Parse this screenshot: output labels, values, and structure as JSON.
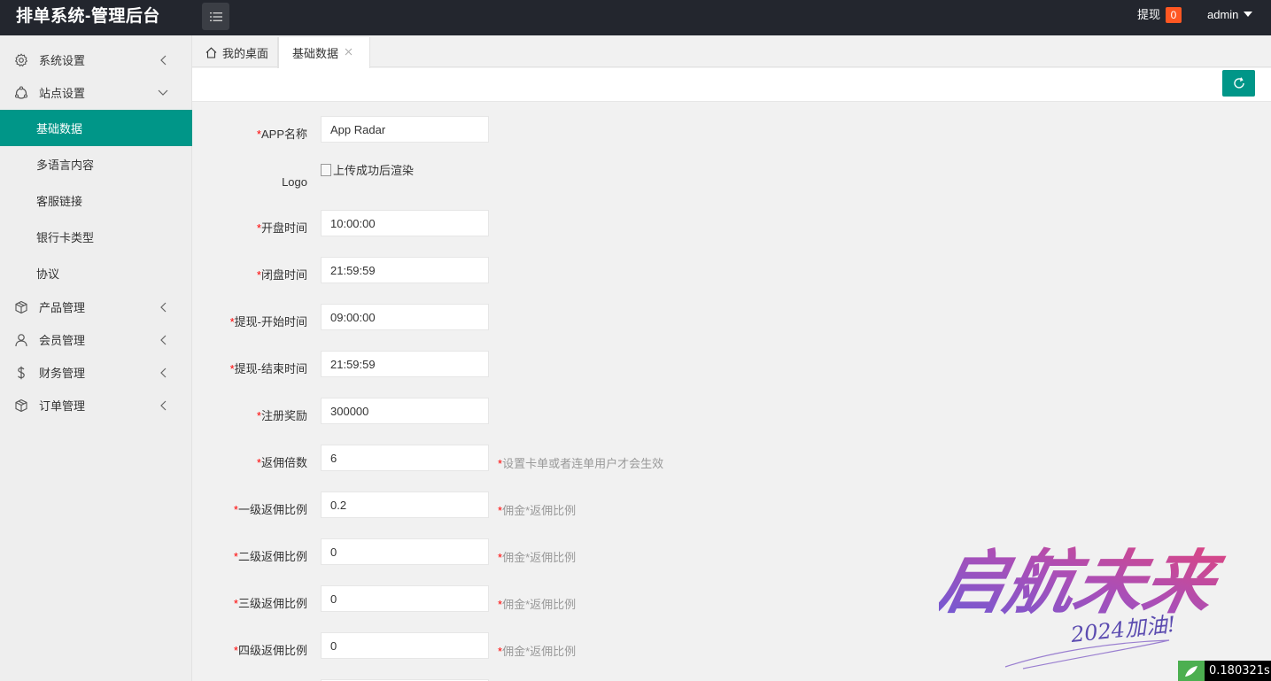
{
  "header": {
    "title": "排单系统-管理后台",
    "withdraw_label": "提现",
    "withdraw_count": "0",
    "username": "admin"
  },
  "sidebar": {
    "items": [
      {
        "label": "系统设置",
        "icon": "gear-icon",
        "expanded": false
      },
      {
        "label": "站点设置",
        "icon": "site-icon",
        "expanded": true
      },
      {
        "label": "产品管理",
        "icon": "box-icon",
        "expanded": false
      },
      {
        "label": "会员管理",
        "icon": "user-icon",
        "expanded": false
      },
      {
        "label": "财务管理",
        "icon": "dollar-icon",
        "expanded": false
      },
      {
        "label": "订单管理",
        "icon": "box-icon",
        "expanded": false
      }
    ],
    "sub_items": [
      {
        "label": "基础数据",
        "active": true
      },
      {
        "label": "多语言内容",
        "active": false
      },
      {
        "label": "客服链接",
        "active": false
      },
      {
        "label": "银行卡类型",
        "active": false
      },
      {
        "label": "协议",
        "active": false
      }
    ]
  },
  "tabs": {
    "home": "我的桌面",
    "active": "基础数据"
  },
  "form": {
    "app_name": {
      "label": "APP名称",
      "value": "App Radar"
    },
    "logo": {
      "label": "Logo",
      "img_alt": "上传成功后渲染"
    },
    "open_time": {
      "label": "开盘时间",
      "value": "10:00:00"
    },
    "close_time": {
      "label": "闭盘时间",
      "value": "21:59:59"
    },
    "withdraw_start": {
      "label": "提现-开始时间",
      "value": "09:00:00"
    },
    "withdraw_end": {
      "label": "提现-结束时间",
      "value": "21:59:59"
    },
    "register_reward": {
      "label": "注册奖励",
      "value": "300000"
    },
    "commission_multiple": {
      "label": "返佣倍数",
      "value": "6",
      "tip": "设置卡单或者连单用户才会生效"
    },
    "level1": {
      "label": "一级返佣比例",
      "value": "0.2",
      "tip": "佣金*返佣比例"
    },
    "level2": {
      "label": "二级返佣比例",
      "value": "0",
      "tip": "佣金*返佣比例"
    },
    "level3": {
      "label": "三级返佣比例",
      "value": "0",
      "tip": "佣金*返佣比例"
    },
    "level4": {
      "label": "四级返佣比例",
      "value": "0",
      "tip": "佣金*返佣比例"
    },
    "required_mark": "*"
  },
  "watermark": {
    "main": "启航未来",
    "sub": "2024加油!"
  },
  "timer": "0.180321s",
  "colors": {
    "accent": "#009688",
    "header": "#23262e",
    "badge": "#ff5722",
    "required": "#ff0000"
  }
}
